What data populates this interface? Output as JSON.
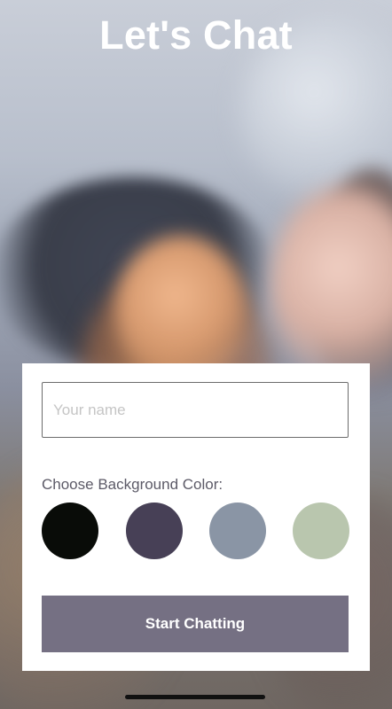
{
  "app": {
    "title": "Let's Chat"
  },
  "form": {
    "name_placeholder": "Your name",
    "name_value": "",
    "choose_label": "Choose Background Color:",
    "colors": [
      {
        "name": "black",
        "hex": "#090C08"
      },
      {
        "name": "purple",
        "hex": "#474056"
      },
      {
        "name": "slate",
        "hex": "#8A95A5"
      },
      {
        "name": "sage",
        "hex": "#B9C6AE"
      }
    ],
    "start_button_label": "Start Chatting",
    "start_button_color": "#757083"
  },
  "ui": {
    "text_color_primary": "#FFFFFF"
  }
}
